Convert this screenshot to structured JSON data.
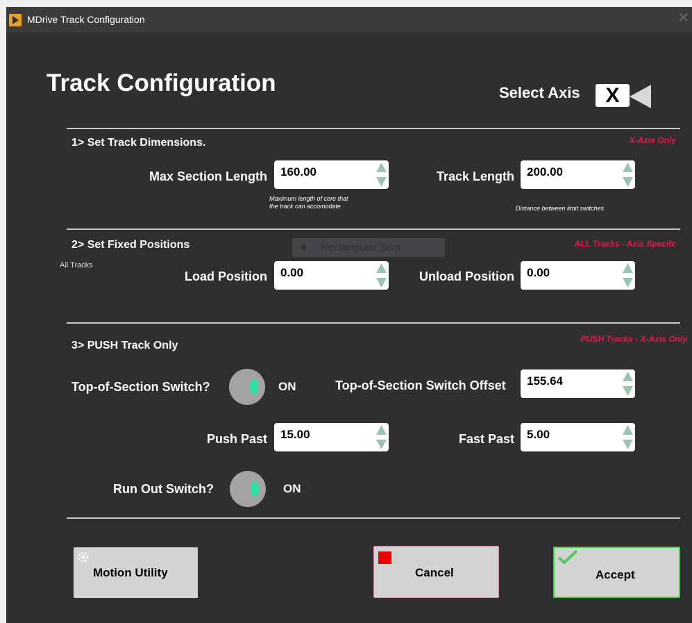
{
  "window": {
    "title": "MDrive Track Configuration"
  },
  "header": {
    "title": "Track Configuration",
    "select_axis_label": "Select Axis",
    "axis_value": "X"
  },
  "section1": {
    "title": "1> Set Track Dimensions.",
    "scope": "X-Axis Only",
    "max_section_length": {
      "label": "Max Section Length",
      "value": "160.00",
      "hint_line1": "Maximum length of core that",
      "hint_line2": "the track can accomodate"
    },
    "track_length": {
      "label": "Track Length",
      "value": "200.00",
      "hint": "Distance between limit switches"
    }
  },
  "section2": {
    "title": "2> Set Fixed Positions",
    "scope": "ALL Tracks - Axis Specifc",
    "note": "All Tracks",
    "load_position": {
      "label": "Load Position",
      "value": "0.00"
    },
    "unload_position": {
      "label": "Unload Position",
      "value": "0.00"
    }
  },
  "overlay": {
    "rectangular_snip": "Rectangular Snip"
  },
  "section3": {
    "title": "3> PUSH Track Only",
    "scope": "PUSH Tracks - X-Axis Only",
    "top_switch": {
      "label": "Top-of-Section Switch?",
      "state": "ON"
    },
    "top_switch_offset": {
      "label": "Top-of-Section Switch Offset",
      "value": "155.64"
    },
    "push_past": {
      "label": "Push Past",
      "value": "15.00"
    },
    "fast_past": {
      "label": "Fast Past",
      "value": "5.00"
    },
    "run_out_switch": {
      "label": "Run Out Switch?",
      "state": "ON"
    }
  },
  "footer": {
    "motion_utility": "Motion Utility",
    "cancel": "Cancel",
    "accept": "Accept"
  },
  "colors": {
    "background": "#2f2f2f",
    "scope_note": "#e8174a",
    "toggle_knob": "#2be2a6",
    "accept_border": "#3fd43f",
    "cancel_border": "#d98f9a"
  }
}
